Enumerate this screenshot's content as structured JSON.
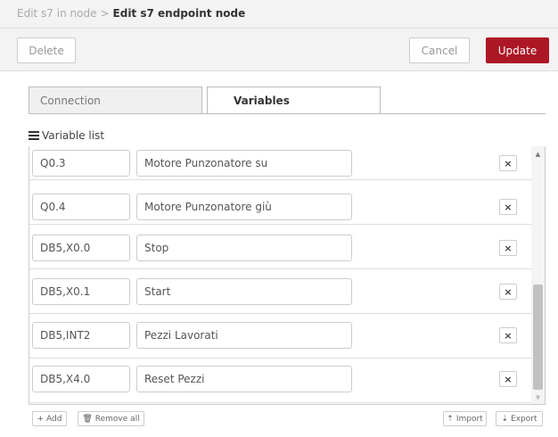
{
  "breadcrumb": {
    "parent": "Edit s7 in node",
    "separator": ">",
    "current": "Edit s7 endpoint node"
  },
  "toolbar": {
    "delete_label": "Delete",
    "cancel_label": "Cancel",
    "update_label": "Update"
  },
  "tabs": [
    {
      "label": "Connection",
      "active": false
    },
    {
      "label": "Variables",
      "active": true
    }
  ],
  "variable_list": {
    "title": "Variable list",
    "icon": "list-icon",
    "rows": [
      {
        "address": "Q0.3",
        "name": "Motore Punzonatore su"
      },
      {
        "address": "Q0.4",
        "name": "Motore Punzonatore giù"
      },
      {
        "address": "DB5,X0.0",
        "name": "Stop"
      },
      {
        "address": "DB5,X0.1",
        "name": "Start"
      },
      {
        "address": "DB5,INT2",
        "name": "Pezzi Lavorati"
      },
      {
        "address": "DB5,X4.0",
        "name": "Reset Pezzi"
      }
    ],
    "remove_glyph": "×"
  },
  "footer": {
    "add_label": "Add",
    "remove_all_label": "Remove all",
    "import_label": "Import",
    "export_label": "Export"
  },
  "colors": {
    "accent": "#ad1625",
    "header_bg": "#f3f3f3"
  }
}
